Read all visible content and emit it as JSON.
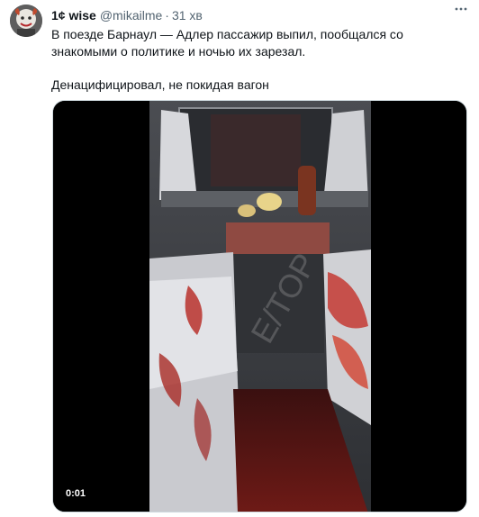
{
  "tweet": {
    "author_name": "1¢ wise",
    "handle": "@mikailme",
    "separator": "·",
    "time": "31 хв",
    "more_icon": "more-horizontal-icon",
    "text_line1": "В поезде Барнаул — Адлер пассажир выпил, пообщался со знакомыми о политике и ночью их зарезал.",
    "text_line2": "Денацифицировал, не покидая вагон",
    "video_time": "0:01"
  }
}
